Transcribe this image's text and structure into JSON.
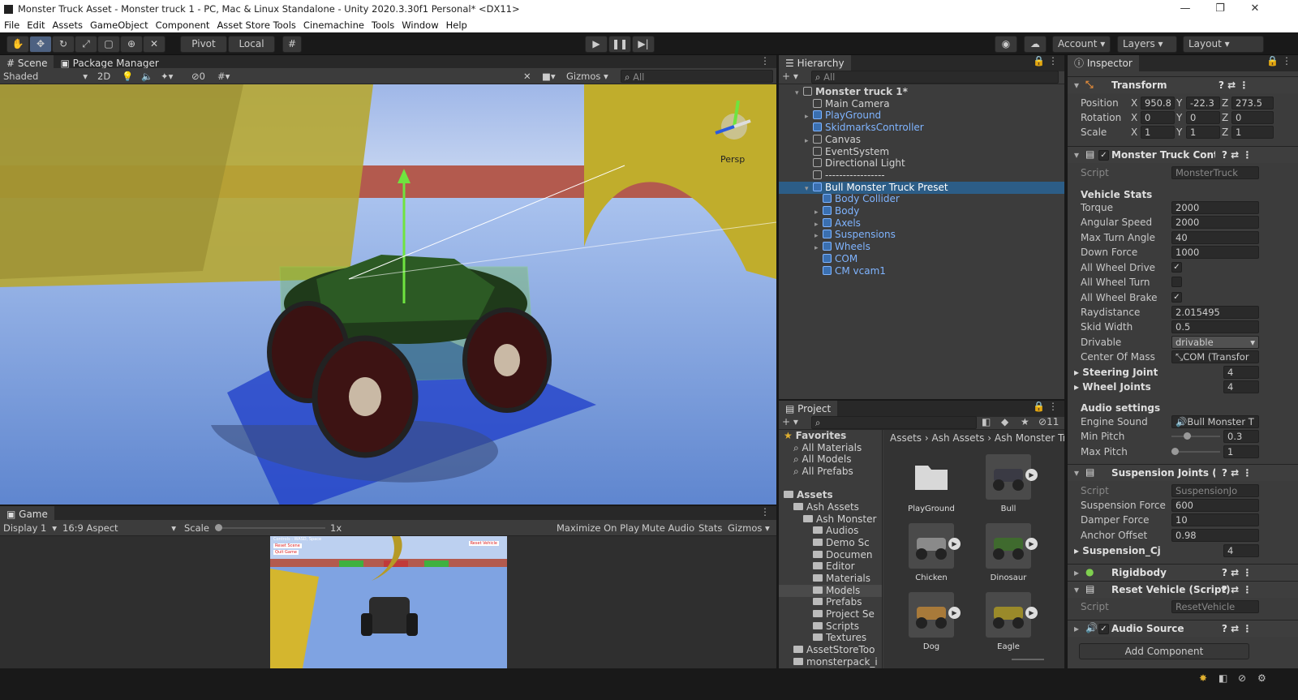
{
  "window": {
    "title": "Monster Truck Asset - Monster truck 1 - PC, Mac & Linux Standalone - Unity 2020.3.30f1 Personal* <DX11>",
    "minimize": "—",
    "maximize": "❐",
    "close": "✕"
  },
  "menu": [
    "File",
    "Edit",
    "Assets",
    "GameObject",
    "Component",
    "Asset Store Tools",
    "Cinemachine",
    "Tools",
    "Window",
    "Help"
  ],
  "toolbar": {
    "pivot": "Pivot",
    "local": "Local",
    "account": "Account",
    "layers": "Layers",
    "layout": "Layout"
  },
  "scene": {
    "tab_scene": "Scene",
    "tab_package": "Package Manager",
    "shading": "Shaded",
    "mode2d": "2D",
    "hidden_count": "0",
    "gizmos": "Gizmos",
    "search": "All",
    "persp": "Persp"
  },
  "game": {
    "tab": "Game",
    "display": "Display 1",
    "aspect": "16:9 Aspect",
    "scale_label": "Scale",
    "scale_value": "1x",
    "maximize": "Maximize On Play",
    "mute": "Mute Audio",
    "stats": "Stats",
    "gizmos": "Gizmos",
    "hud_controls": "Controls : WASD, Space",
    "hud_reset": "Reset Scene",
    "hud_quit": "Quit Game",
    "hud_reset_vehicle": "Reset Vehicle"
  },
  "hierarchy": {
    "tab": "Hierarchy",
    "search": "All",
    "items": [
      {
        "label": "Monster truck 1*",
        "depth": 0,
        "expanded": true,
        "bold": true,
        "type": "scene"
      },
      {
        "label": "Main Camera",
        "depth": 1,
        "type": "obj"
      },
      {
        "label": "PlayGround",
        "depth": 1,
        "type": "prefab",
        "arrow": true
      },
      {
        "label": "SkidmarksController",
        "depth": 1,
        "type": "prefab"
      },
      {
        "label": "Canvas",
        "depth": 1,
        "type": "obj",
        "arrow": true
      },
      {
        "label": "EventSystem",
        "depth": 1,
        "type": "obj"
      },
      {
        "label": "Directional Light",
        "depth": 1,
        "type": "obj"
      },
      {
        "label": "-----------------",
        "depth": 1,
        "type": "obj"
      },
      {
        "label": "Bull Monster Truck Preset",
        "depth": 1,
        "type": "prefab",
        "expanded": true,
        "selected": true
      },
      {
        "label": "Body Collider",
        "depth": 2,
        "type": "prefab"
      },
      {
        "label": "Body",
        "depth": 2,
        "type": "prefab",
        "arrow": true
      },
      {
        "label": "Axels",
        "depth": 2,
        "type": "prefab",
        "arrow": true
      },
      {
        "label": "Suspensions",
        "depth": 2,
        "type": "prefab",
        "arrow": true
      },
      {
        "label": "Wheels",
        "depth": 2,
        "type": "prefab",
        "arrow": true
      },
      {
        "label": "COM",
        "depth": 2,
        "type": "prefab"
      },
      {
        "label": "CM vcam1",
        "depth": 2,
        "type": "prefab"
      }
    ]
  },
  "project": {
    "tab": "Project",
    "hidden_count": "11",
    "breadcrumb": [
      "Assets",
      "Ash Assets",
      "Ash Monster Truc"
    ],
    "tree": [
      {
        "label": "Favorites",
        "depth": 0,
        "bold": true
      },
      {
        "label": "All Materials",
        "depth": 1
      },
      {
        "label": "All Models",
        "depth": 1
      },
      {
        "label": "All Prefabs",
        "depth": 1
      },
      {
        "label": "Assets",
        "depth": 0,
        "bold": true
      },
      {
        "label": "Ash Assets",
        "depth": 1
      },
      {
        "label": "Ash Monster",
        "depth": 2
      },
      {
        "label": "Audios",
        "depth": 3
      },
      {
        "label": "Demo Sc",
        "depth": 3
      },
      {
        "label": "Documen",
        "depth": 3
      },
      {
        "label": "Editor",
        "depth": 3
      },
      {
        "label": "Materials",
        "depth": 3
      },
      {
        "label": "Models",
        "depth": 3,
        "selected": true
      },
      {
        "label": "Prefabs",
        "depth": 3
      },
      {
        "label": "Project Se",
        "depth": 3
      },
      {
        "label": "Scripts",
        "depth": 3
      },
      {
        "label": "Textures",
        "depth": 3
      },
      {
        "label": "AssetStoreToo",
        "depth": 1
      },
      {
        "label": "monsterpack_i",
        "depth": 1
      }
    ],
    "assets": [
      {
        "label": "PlayGround",
        "kind": "folder"
      },
      {
        "label": "Bull",
        "kind": "model",
        "color": "#3a3a44"
      },
      {
        "label": "Chicken",
        "kind": "model",
        "color": "#8a8a8a"
      },
      {
        "label": "Dinosaur",
        "kind": "model",
        "color": "#3f6a2e"
      },
      {
        "label": "Dog",
        "kind": "model",
        "color": "#a87a3a"
      },
      {
        "label": "Eagle",
        "kind": "model",
        "color": "#9a8a2a"
      }
    ]
  },
  "inspector": {
    "tab": "Inspector",
    "transform": {
      "title": "Transform",
      "position": {
        "label": "Position",
        "x": "950.8",
        "y": "-22.3",
        "z": "273.5"
      },
      "rotation": {
        "label": "Rotation",
        "x": "0",
        "y": "0",
        "z": "0"
      },
      "scale": {
        "label": "Scale",
        "x": "1",
        "y": "1",
        "z": "1"
      }
    },
    "mtc": {
      "title": "Monster Truck Control",
      "script_label": "Script",
      "script_value": "MonsterTruck",
      "section": "Vehicle Stats",
      "fields": [
        {
          "label": "Torque",
          "value": "2000"
        },
        {
          "label": "Angular Speed",
          "value": "2000"
        },
        {
          "label": "Max Turn Angle",
          "value": "40"
        },
        {
          "label": "Down Force",
          "value": "1000"
        }
      ],
      "all_wheel_drive": "All Wheel Drive",
      "all_wheel_turn": "All Wheel Turn",
      "all_wheel_brake": "All Wheel Brake",
      "raydistance": {
        "label": "Raydistance",
        "value": "2.015495"
      },
      "skid_width": {
        "label": "Skid Width",
        "value": "0.5"
      },
      "drivable": {
        "label": "Drivable",
        "value": "drivable"
      },
      "com": {
        "label": "Center Of Mass",
        "value": "COM (Transfor"
      },
      "steering": {
        "label": "Steering Joint",
        "value": "4"
      },
      "wheels": {
        "label": "Wheel Joints",
        "value": "4"
      },
      "audio_section": "Audio settings",
      "engine_sound": {
        "label": "Engine Sound",
        "value": "Bull Monster T"
      },
      "min_pitch": {
        "label": "Min Pitch",
        "value": "0.3",
        "level": 0.3
      },
      "max_pitch": {
        "label": "Max Pitch",
        "value": "1",
        "level": 0.0
      }
    },
    "suspension": {
      "title": "Suspension Joints (Sc",
      "script_label": "Script",
      "script_value": "SuspensionJo",
      "force": {
        "label": "Suspension Force",
        "value": "600"
      },
      "damper": {
        "label": "Damper Force",
        "value": "10"
      },
      "anchor": {
        "label": "Anchor Offset",
        "value": "0.98"
      },
      "joints": {
        "label": "Suspension_Cj",
        "value": "4"
      }
    },
    "rigidbody": "Rigidbody",
    "reset": {
      "title": "Reset Vehicle (Script)",
      "script_label": "Script",
      "script_value": "ResetVehicle"
    },
    "audio_source": "Audio Source",
    "add_component": "Add Component"
  }
}
